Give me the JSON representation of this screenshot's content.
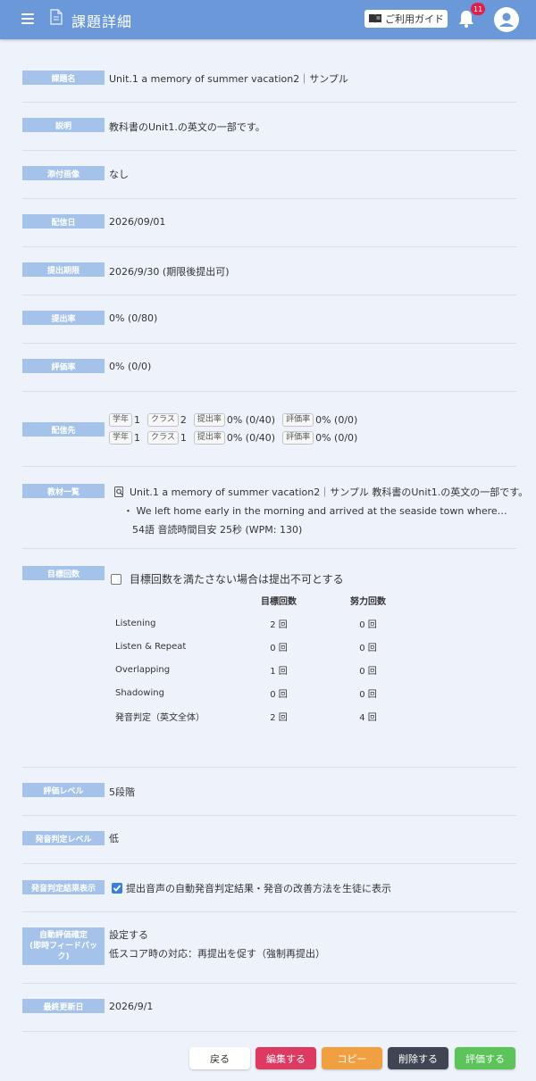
{
  "header": {
    "title": "課題詳細",
    "guide_label": "ご利用ガイド",
    "notification_count": "11"
  },
  "fields": {
    "title": {
      "label": "課題名",
      "value": "Unit.1 a memory of summer vacation2｜サンプル"
    },
    "description": {
      "label": "説明",
      "value": "教科書のUnit1.の英文の一部です。"
    },
    "attachment": {
      "label": "添付画像",
      "value": "なし"
    },
    "delivery_date": {
      "label": "配信日",
      "value": "2026/09/01"
    },
    "deadline": {
      "label": "提出期限",
      "value": "2026/9/30 (期限後提出可)"
    },
    "submission_rate": {
      "label": "提出率",
      "value": "0% (0/80)"
    },
    "evaluation_rate": {
      "label": "評価率",
      "value": "0% (0/0)"
    },
    "destination": {
      "label": "配信先",
      "tag_grade": "学年",
      "tag_class": "クラス",
      "tag_submit": "提出率",
      "tag_eval": "評価率",
      "rows": [
        {
          "grade": "1",
          "class": "2",
          "submit": "0% (0/40)",
          "eval": "0% (0/0)"
        },
        {
          "grade": "1",
          "class": "1",
          "submit": "0% (0/40)",
          "eval": "0% (0/0)"
        }
      ]
    },
    "materials": {
      "label": "教材一覧",
      "title": "Unit.1 a memory of summer vacation2｜サンプル 教科書のUnit1.の英文の一部です。",
      "excerpt": "・ We left home early in the morning and arrived at the seaside town where my uncle lives by ...",
      "meta": "54語  音読時間目安 25秒 (WPM: 130)"
    },
    "target": {
      "label": "目標回数",
      "checkbox_label": "目標回数を満たさない場合は提出不可とする",
      "col_target": "目標回数",
      "col_effort": "努力回数",
      "rows": [
        {
          "name": "Listening",
          "target": "2 回",
          "effort": "0 回"
        },
        {
          "name": "Listen & Repeat",
          "target": "0 回",
          "effort": "0 回"
        },
        {
          "name": "Overlapping",
          "target": "1 回",
          "effort": "0 回"
        },
        {
          "name": "Shadowing",
          "target": "0 回",
          "effort": "0 回"
        },
        {
          "name": "発音判定（英文全体）",
          "target": "2 回",
          "effort": "4 回"
        }
      ]
    },
    "eval_level": {
      "label": "評価レベル",
      "value": "5段階"
    },
    "pron_level": {
      "label": "発音判定レベル",
      "value": "低"
    },
    "pron_display": {
      "label": "発音判定結果表示",
      "value": "提出音声の自動発音判定結果・発音の改善方法を生徒に表示"
    },
    "auto_eval": {
      "label": "自動評価確定\n(即時フィードバック)",
      "value1": "設定する",
      "value2": "低スコア時の対応：再提出を促す（強制再提出）"
    },
    "last_updated": {
      "label": "最終更新日",
      "value": "2026/9/1"
    }
  },
  "buttons": {
    "back": "戻る",
    "edit": "編集する",
    "copy": "コピー",
    "delete": "削除する",
    "evaluate": "評価する"
  },
  "colors": {
    "header": "#6a98d8",
    "label_bg": "#a5c3ea",
    "edit": "#dd3a62",
    "copy": "#f0a040",
    "delete": "#3f4552",
    "evaluate": "#5cc45a"
  }
}
